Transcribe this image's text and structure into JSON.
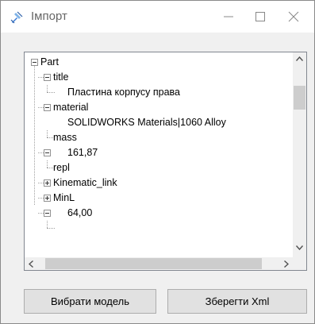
{
  "window": {
    "title": "Імпорт"
  },
  "tree": {
    "nodes": [
      {
        "label": "Part",
        "state": "expanded"
      },
      {
        "label": "title",
        "state": "expanded"
      },
      {
        "label": "Пластина корпусу права",
        "state": "leaf"
      },
      {
        "label": "material",
        "state": "expanded"
      },
      {
        "label": "SOLIDWORKS Materials|1060 Alloy",
        "state": "leaf"
      },
      {
        "label": "mass",
        "state": "expanded"
      },
      {
        "label": "161,87",
        "state": "leaf"
      },
      {
        "label": "repl",
        "state": "collapsed"
      },
      {
        "label": "Kinematic_link",
        "state": "collapsed"
      },
      {
        "label": "MinL",
        "state": "expanded"
      },
      {
        "label": "64,00",
        "state": "leaf"
      }
    ]
  },
  "buttons": {
    "select_model": "Вибрати модель",
    "save_xml": "Зберегти Xml"
  },
  "colors": {
    "window_border": "#8a8a8a",
    "background": "#f0f0f0",
    "button_face": "#e1e1e1"
  }
}
